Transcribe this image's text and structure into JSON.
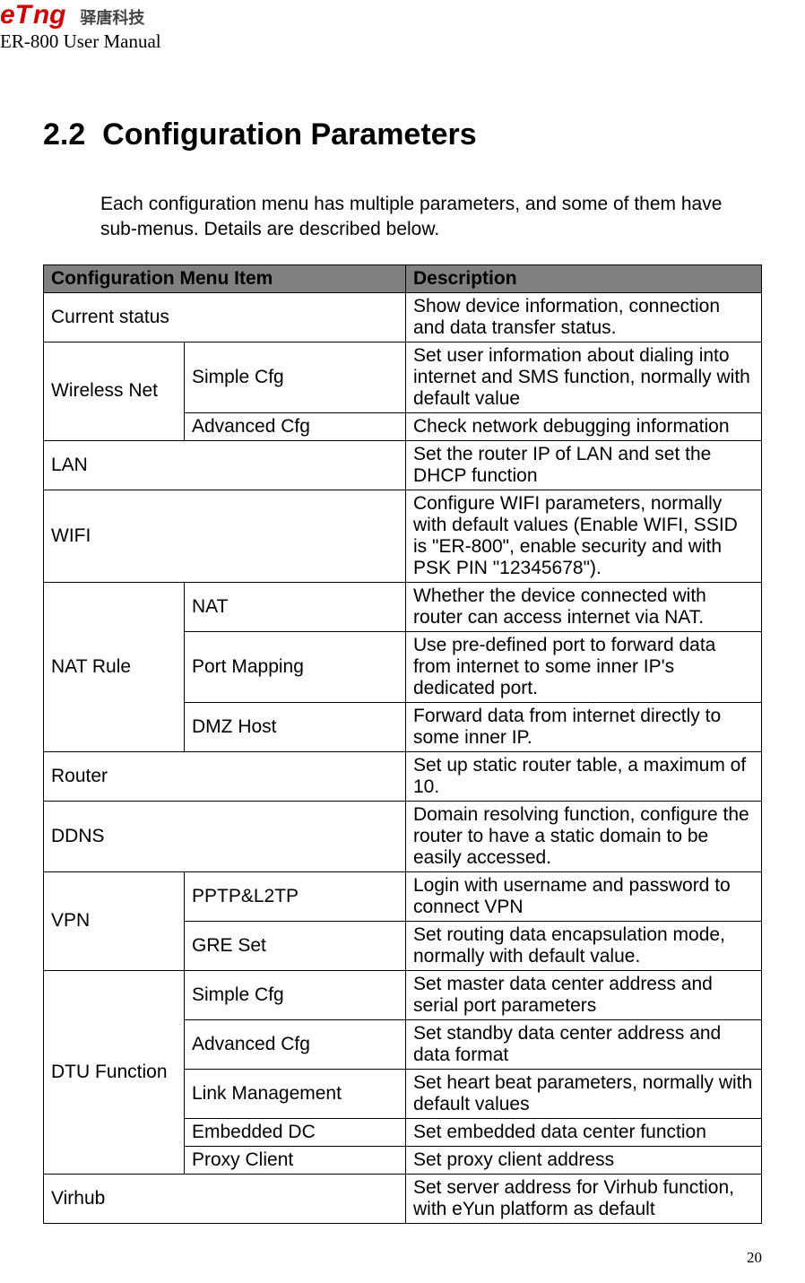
{
  "header": {
    "logo_text": "eT",
    "logo_text2": "ng",
    "logo_cn": "驿唐科技",
    "manual_title": "ER-800 User Manual"
  },
  "section": {
    "number": "2.2",
    "title": "Configuration Parameters",
    "intro": "Each configuration menu has multiple parameters, and some of them have sub-menus. Details are described below."
  },
  "table": {
    "head_menu": "Configuration Menu Item",
    "head_desc": "Description",
    "rows": [
      {
        "menu": "Current status",
        "sub": null,
        "desc": "Show device information, connection and data transfer status."
      },
      {
        "menu": "Wireless Net",
        "sub": "Simple Cfg",
        "desc": "Set user information about dialing into internet and SMS function, normally with default value"
      },
      {
        "menu": null,
        "sub": "Advanced Cfg",
        "desc": "Check network debugging information"
      },
      {
        "menu": "LAN",
        "sub": null,
        "desc": "Set the router IP of LAN and set the DHCP function"
      },
      {
        "menu": "WIFI",
        "sub": null,
        "desc": "Configure WIFI parameters, normally with default values (Enable WIFI, SSID is \"ER-800\", enable security and with PSK PIN \"12345678\")."
      },
      {
        "menu": "NAT Rule",
        "sub": "NAT",
        "desc": "Whether the device connected with router can access internet via NAT."
      },
      {
        "menu": null,
        "sub": "Port Mapping",
        "desc": "Use pre-defined port to forward data from internet to some inner IP's dedicated port."
      },
      {
        "menu": null,
        "sub": "DMZ Host",
        "desc": "Forward data from internet directly to some inner IP."
      },
      {
        "menu": "Router",
        "sub": null,
        "desc": "Set up static router table, a maximum of 10."
      },
      {
        "menu": "DDNS",
        "sub": null,
        "desc": "Domain resolving function, configure the router to have a static domain to be easily accessed."
      },
      {
        "menu": "VPN",
        "sub": "PPTP&L2TP",
        "desc": "Login with username and password to connect VPN"
      },
      {
        "menu": null,
        "sub": "GRE Set",
        "desc": "Set routing data encapsulation mode, normally with default value."
      },
      {
        "menu": "DTU Function",
        "sub": "Simple Cfg",
        "desc": "Set master data center address and serial port parameters"
      },
      {
        "menu": null,
        "sub": "Advanced Cfg",
        "desc": "Set standby data center address and data format"
      },
      {
        "menu": null,
        "sub": "Link Management",
        "desc": "Set heart beat parameters, normally with default values"
      },
      {
        "menu": null,
        "sub": "Embedded DC",
        "desc": "Set embedded data center function"
      },
      {
        "menu": null,
        "sub": "Proxy Client",
        "desc": "Set proxy client address"
      },
      {
        "menu": "Virhub",
        "sub": null,
        "desc": "Set server address for Virhub function, with eYun platform as default"
      }
    ]
  },
  "page_number": "20"
}
